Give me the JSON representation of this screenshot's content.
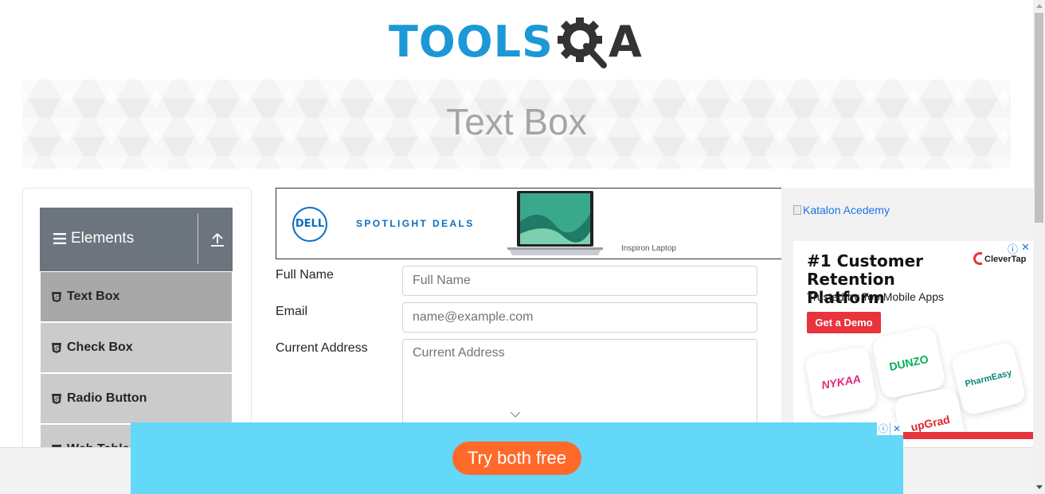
{
  "header": {
    "logo_text": "TOOLS",
    "logo_suffix": "A"
  },
  "banner": {
    "page_title": "Text Box"
  },
  "sidebar": {
    "group_title": "Elements",
    "items": [
      {
        "label": "Text Box",
        "active": true
      },
      {
        "label": "Check Box",
        "active": false
      },
      {
        "label": "Radio Button",
        "active": false
      },
      {
        "label": "Web Tables",
        "active": false
      }
    ]
  },
  "dell_ad": {
    "logo": "DELL",
    "headline": "SPOTLIGHT DEALS",
    "caption": "Inspiron Laptop"
  },
  "form": {
    "full_name": {
      "label": "Full Name",
      "placeholder": "Full Name",
      "value": ""
    },
    "email": {
      "label": "Email",
      "placeholder": "name@example.com",
      "value": ""
    },
    "current_address": {
      "label": "Current Address",
      "placeholder": "Current Address",
      "value": ""
    }
  },
  "right_ad": {
    "broken_image_alt": "Katalon Acedemy",
    "headline": "#1 Customer Retention Platform",
    "subline": "Trusted by Top Mobile Apps",
    "cta": "Get a Demo",
    "brand": "CleverTap",
    "tiles": [
      "NYKAA",
      "DUNZO",
      "PharmEasy",
      "upGrad"
    ]
  },
  "bottom_ad": {
    "cta": "Try both free",
    "info_icon": "ⓘ",
    "close_icon": "✕"
  },
  "colors": {
    "logo_blue": "#1c98d6",
    "logo_dark": "#333333",
    "sidebar_header": "#6c757d",
    "menu_item": "#cbcbcb",
    "menu_item_active": "#a8a8a8",
    "ad_cyan": "#63d8f8",
    "ad_orange": "#ff6a2a",
    "clevertap_red": "#e8343c"
  }
}
